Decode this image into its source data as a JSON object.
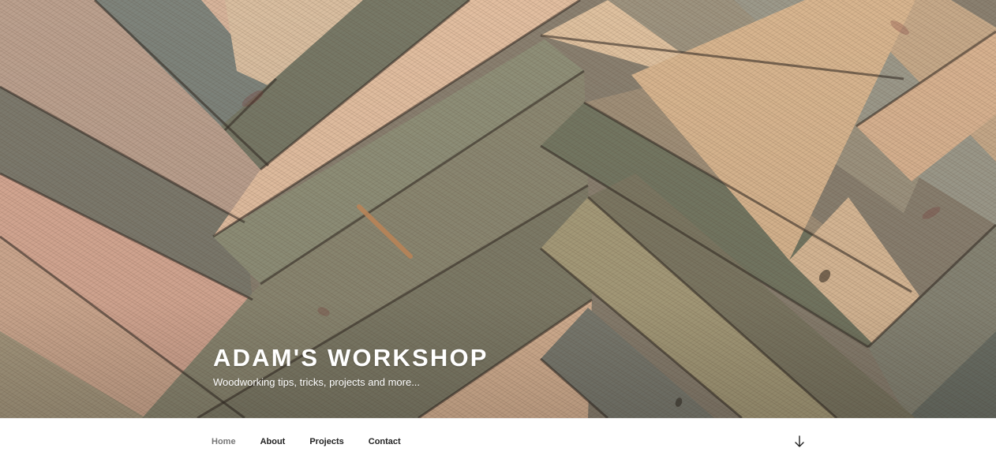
{
  "site": {
    "title": "ADAM'S WORKSHOP",
    "description": "Woodworking tips, tricks, projects and more..."
  },
  "navigation": {
    "items": [
      {
        "label": "Home",
        "current": true
      },
      {
        "label": "About",
        "current": false
      },
      {
        "label": "Projects",
        "current": false
      },
      {
        "label": "Contact",
        "current": false
      }
    ]
  },
  "scroll_control": {
    "icon": "arrow-down-icon"
  },
  "header_image": {
    "subject": "herringbone reclaimed wood wall",
    "colors": {
      "light_wood": "#d8b896",
      "pale_wood": "#dfc2a3",
      "pink_wood": "#d7a895",
      "gray_wood": "#8d8a7a",
      "weathered_wood": "#777866",
      "olive_wood": "#9d987d"
    }
  },
  "theme": {
    "accent": "#222222",
    "current_nav": "#767676",
    "hero_text": "#ffffff"
  }
}
